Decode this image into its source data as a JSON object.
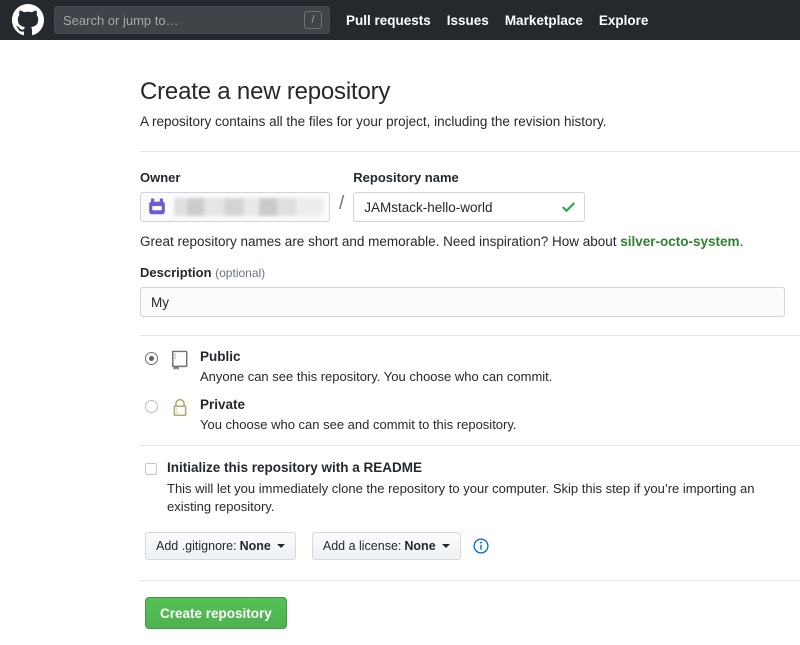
{
  "header": {
    "logo_icon": "github-octocat-icon",
    "search": {
      "placeholder": "Search or jump to…",
      "value": "",
      "shortcut_badge": "/"
    },
    "nav": [
      {
        "label": "Pull requests"
      },
      {
        "label": "Issues"
      },
      {
        "label": "Marketplace"
      },
      {
        "label": "Explore"
      }
    ]
  },
  "page": {
    "title": "Create a new repository",
    "subtitle": "A repository contains all the files for your project, including the revision history."
  },
  "owner": {
    "label": "Owner",
    "avatar_icon": "bot-avatar-icon",
    "name": "",
    "separator": "/"
  },
  "repository": {
    "label": "Repository name",
    "value": "JAMstack-hello-world",
    "placeholder": "",
    "valid_icon": "check-icon"
  },
  "hint": {
    "before": "Great repository names are short and memorable. Need inspiration? How about ",
    "suggestion": "silver-octo-system",
    "after": "."
  },
  "description": {
    "label": "Description",
    "optional": "(optional)",
    "value": "My",
    "placeholder": ""
  },
  "visibility": {
    "options": [
      {
        "name": "Public",
        "description": "Anyone can see this repository. You choose who can commit.",
        "icon": "repo-book-icon",
        "selected": true
      },
      {
        "name": "Private",
        "description": "You choose who can see and commit to this repository.",
        "icon": "lock-icon",
        "selected": false
      }
    ]
  },
  "readme": {
    "label": "Initialize this repository with a README",
    "description": "This will let you immediately clone the repository to your computer. Skip this step if you’re importing an existing repository.",
    "checked": false
  },
  "dropdowns": {
    "gitignore": {
      "prefix": "Add .gitignore:",
      "value": "None",
      "caret_icon": "caret-down-icon"
    },
    "license": {
      "prefix": "Add a license:",
      "value": "None",
      "caret_icon": "caret-down-icon"
    },
    "info_icon": "info-circle-icon"
  },
  "submit": {
    "label": "Create repository"
  },
  "colors": {
    "header_bg": "#24292e",
    "link_green": "#2f8132",
    "button_green": "#55c156",
    "check_green": "#28a745",
    "lock_gold": "#b5a96a",
    "avatar_purple": "#6f5ad4",
    "info_blue": "#0366d6"
  }
}
